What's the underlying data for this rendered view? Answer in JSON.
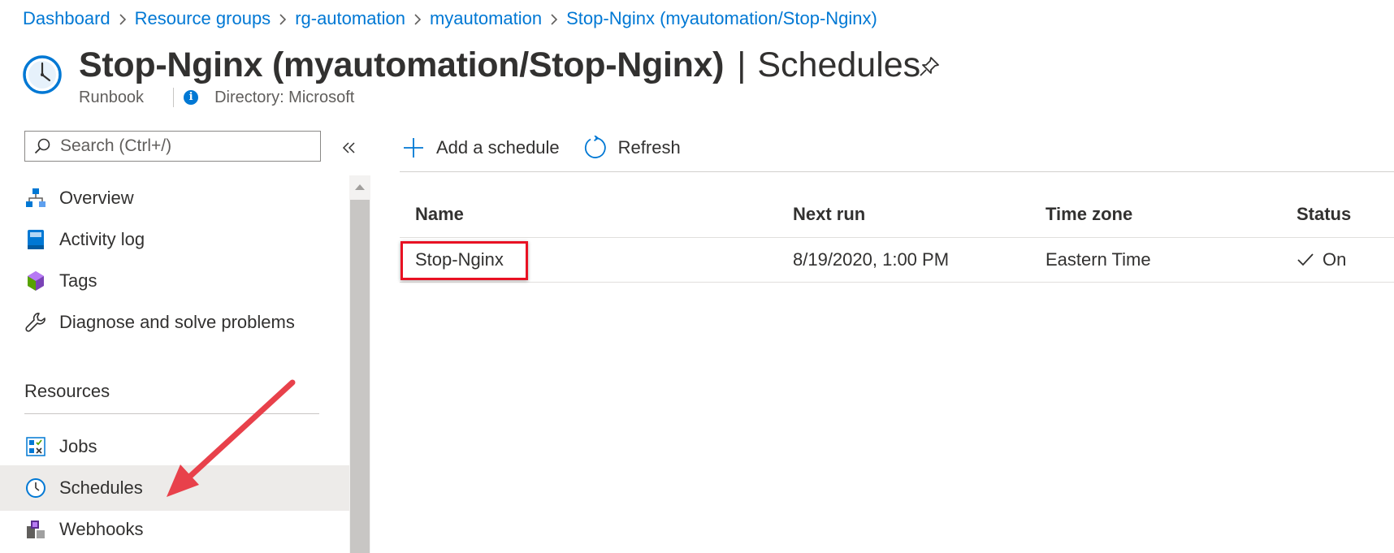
{
  "breadcrumb": {
    "items": [
      "Dashboard",
      "Resource groups",
      "rg-automation",
      "myautomation",
      "Stop-Nginx (myautomation/Stop-Nginx)"
    ]
  },
  "header": {
    "resource_name": "Stop-Nginx (myautomation/Stop-Nginx)",
    "separator": "|",
    "blade_name": "Schedules",
    "resource_type": "Runbook",
    "directory": "Directory: Microsoft"
  },
  "search": {
    "placeholder": "Search (Ctrl+/)"
  },
  "menu": {
    "items": [
      {
        "label": "Overview",
        "icon": "overview-icon"
      },
      {
        "label": "Activity log",
        "icon": "activity-log-icon"
      },
      {
        "label": "Tags",
        "icon": "tags-icon"
      },
      {
        "label": "Diagnose and solve problems",
        "icon": "wrench-icon"
      }
    ],
    "section_title": "Resources",
    "resource_items": [
      {
        "label": "Jobs",
        "icon": "jobs-icon"
      },
      {
        "label": "Schedules",
        "icon": "clock-icon",
        "selected": true
      },
      {
        "label": "Webhooks",
        "icon": "webhooks-icon"
      }
    ]
  },
  "toolbar": {
    "add_label": "Add a schedule",
    "refresh_label": "Refresh"
  },
  "grid": {
    "columns": [
      "Name",
      "Next run",
      "Time zone",
      "Status"
    ],
    "rows": [
      {
        "name": "Stop-Nginx",
        "next_run": "8/19/2020, 1:00 PM",
        "time_zone": "Eastern Time",
        "status": "On"
      }
    ]
  },
  "colors": {
    "accent": "#0078d4",
    "selected_bg": "#edebe9",
    "highlight": "#e81123",
    "arrow": "#e8414b"
  }
}
